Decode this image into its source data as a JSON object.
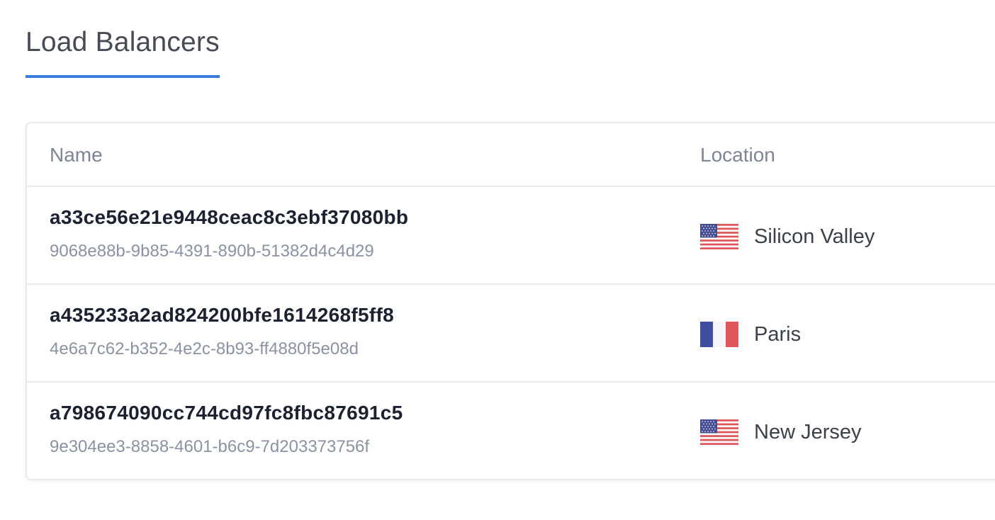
{
  "header": {
    "title": "Load Balancers",
    "accent_color": "#3b7ddd"
  },
  "table": {
    "columns": [
      "Name",
      "Location"
    ],
    "rows": [
      {
        "name": "a33ce56e21e9448ceac8c3ebf37080bb",
        "id": "9068e88b-9b85-4391-890b-51382d4c4d29",
        "location": "Silicon Valley",
        "flag": "us-flag-icon"
      },
      {
        "name": "a435233a2ad824200bfe1614268f5ff8",
        "id": "4e6a7c62-b352-4e2c-8b93-ff4880f5e08d",
        "location": "Paris",
        "flag": "fr-flag-icon"
      },
      {
        "name": "a798674090cc744cd97fc8fbc87691c5",
        "id": "9e304ee3-8858-4601-b6c9-7d203373756f",
        "location": "New Jersey",
        "flag": "us-flag-icon"
      }
    ]
  }
}
